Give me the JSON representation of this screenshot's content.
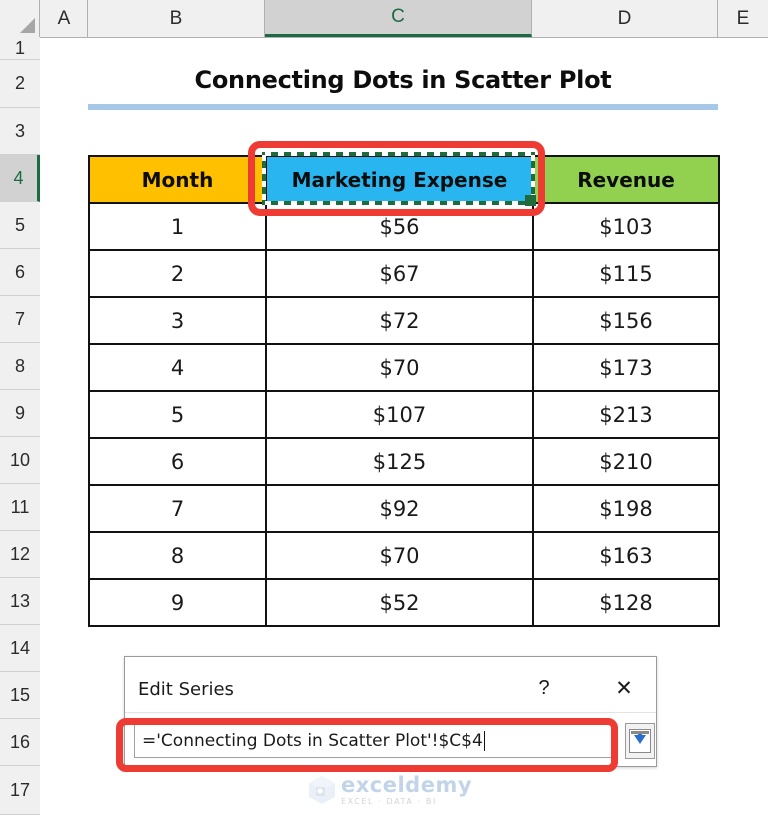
{
  "spreadsheet": {
    "column_headers": [
      "A",
      "B",
      "C",
      "D",
      "E"
    ],
    "active_column": "C",
    "row_headers": [
      "1",
      "2",
      "3",
      "4",
      "5",
      "6",
      "7",
      "8",
      "9",
      "10",
      "11",
      "12",
      "13",
      "14",
      "15",
      "16",
      "17"
    ],
    "active_row": "4",
    "select_all_icon": "select-all-triangle-icon"
  },
  "sheet": {
    "title": "Connecting Dots in Scatter Plot"
  },
  "table": {
    "headers": [
      "Month",
      "Marketing Expense",
      "Revenue"
    ],
    "header_colors": {
      "month": "#ffc000",
      "marketing_expense": "#29b6f0",
      "revenue": "#92d050"
    },
    "selected_header": "Marketing Expense",
    "rows": [
      {
        "month": "1",
        "expense": "$56",
        "revenue": "$103"
      },
      {
        "month": "2",
        "expense": "$67",
        "revenue": "$115"
      },
      {
        "month": "3",
        "expense": "$72",
        "revenue": "$156"
      },
      {
        "month": "4",
        "expense": "$70",
        "revenue": "$173"
      },
      {
        "month": "5",
        "expense": "$107",
        "revenue": "$213"
      },
      {
        "month": "6",
        "expense": "$125",
        "revenue": "$210"
      },
      {
        "month": "7",
        "expense": "$92",
        "revenue": "$198"
      },
      {
        "month": "8",
        "expense": "$70",
        "revenue": "$163"
      },
      {
        "month": "9",
        "expense": "$52",
        "revenue": "$128"
      }
    ]
  },
  "dialog": {
    "title": "Edit Series",
    "help_label": "?",
    "close_label": "✕",
    "series_name_value": "='Connecting Dots in Scatter Plot'!$C$4",
    "collapse_icon": "range-selector-collapse-icon"
  },
  "annotations": {
    "highlight_color": "#ee3b33",
    "selection_border_color": "#1f6b3b"
  },
  "watermark": {
    "name": "exceldemy",
    "tagline": "EXCEL · DATA · BI"
  }
}
